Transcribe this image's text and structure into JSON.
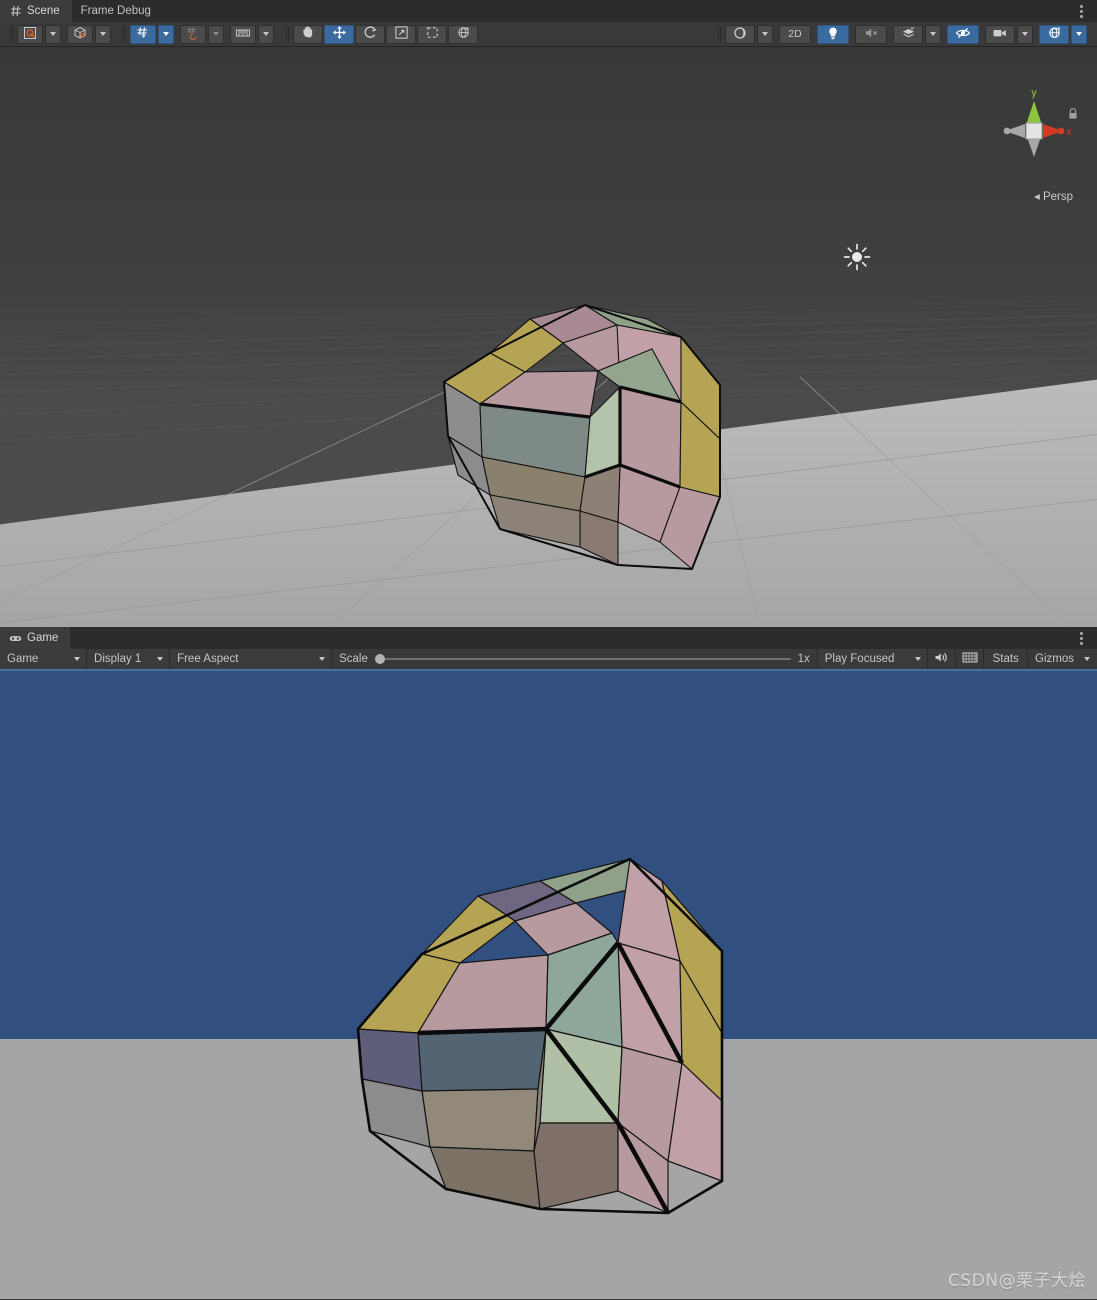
{
  "window": {
    "tabs": [
      {
        "label": "Scene",
        "icon": "grid-hash-icon",
        "active": true
      },
      {
        "label": "Frame Debug",
        "icon": "none",
        "active": false
      }
    ],
    "overflow_menu": "kebab-menu-icon"
  },
  "scene_toolbar": {
    "groups": [
      {
        "name": "pivot-group",
        "items": [
          {
            "name": "pivot-mode-button",
            "icon": "pivot-center-icon",
            "label": "",
            "active": false,
            "dropdown": true
          },
          {
            "name": "handle-orientation-button",
            "icon": "global-local-cube-icon",
            "label": "",
            "active": false,
            "dropdown": true
          }
        ]
      },
      {
        "name": "snap-group",
        "items": [
          {
            "name": "grid-snap-button",
            "icon": "grid-snap-icon",
            "label": "",
            "active": true,
            "dropdown": true
          },
          {
            "name": "surface-snap-button",
            "icon": "surface-snap-icon",
            "label": "",
            "active": false,
            "dropdown": true
          },
          {
            "name": "grid-size-button",
            "icon": "grid-ruler-icon",
            "label": "",
            "active": false,
            "dropdown": true
          }
        ]
      },
      {
        "name": "transform-tools-group",
        "items": [
          {
            "name": "hand-tool-button",
            "icon": "hand-icon",
            "label": "",
            "active": false,
            "dropdown": false
          },
          {
            "name": "move-tool-button",
            "icon": "move-arrows-icon",
            "label": "",
            "active": true,
            "dropdown": false
          },
          {
            "name": "rotate-tool-button",
            "icon": "rotate-icon",
            "label": "",
            "active": false,
            "dropdown": false
          },
          {
            "name": "scale-tool-button",
            "icon": "scale-icon",
            "label": "",
            "active": false,
            "dropdown": false
          },
          {
            "name": "rect-tool-button",
            "icon": "rect-transform-icon",
            "label": "",
            "active": false,
            "dropdown": false
          },
          {
            "name": "transform-tool-button",
            "icon": "transform-combined-icon",
            "label": "",
            "active": false,
            "dropdown": false
          }
        ]
      }
    ],
    "right_items": [
      {
        "name": "draw-mode-button",
        "icon": "shaded-sphere-icon",
        "label": "",
        "active": false,
        "dropdown": true
      },
      {
        "name": "2d-toggle-button",
        "icon": "none",
        "label": "2D",
        "active": false,
        "dropdown": false
      },
      {
        "name": "scene-lighting-button",
        "icon": "lightbulb-icon",
        "label": "",
        "active": true,
        "dropdown": false
      },
      {
        "name": "scene-audio-button",
        "icon": "audio-muted-icon",
        "label": "",
        "active": false,
        "dropdown": false
      },
      {
        "name": "fx-button",
        "icon": "effects-layers-icon",
        "label": "",
        "active": false,
        "dropdown": true
      },
      {
        "name": "scene-visibility-button",
        "icon": "eye-crossed-icon",
        "label": "",
        "active": true,
        "dropdown": false
      },
      {
        "name": "camera-settings-button",
        "icon": "camera-icon",
        "label": "",
        "active": false,
        "dropdown": true
      },
      {
        "name": "gizmos-button",
        "icon": "gizmos-globe-icon",
        "label": "",
        "active": true,
        "dropdown": true
      }
    ]
  },
  "scene_view": {
    "axis_gizmo": {
      "y_label": "y",
      "x_label": "x",
      "y_color": "#8ec73f",
      "x_color": "#d33b26",
      "z_color": "#a8a8a8",
      "center_color": "#e4e4e4"
    },
    "projection_label": "Persp",
    "lock_icon": "padlock-icon",
    "light_gizmo_icon": "directional-light-sun-icon",
    "background_color": "#3f3f3f",
    "ground_color": "#b0b0b0",
    "grid_color": "#6e6e6e"
  },
  "game_panel": {
    "tab": {
      "label": "Game",
      "icon": "gamepad-icon"
    },
    "overflow_menu": "kebab-menu-icon",
    "toolbar": {
      "view_selector": {
        "name": "game-view-selector",
        "value": "Game"
      },
      "display_selector": {
        "name": "display-selector",
        "value": "Display 1"
      },
      "aspect_selector": {
        "name": "aspect-ratio-selector",
        "value": "Free Aspect"
      },
      "scale": {
        "label": "Scale",
        "value": "1x",
        "percent": 0
      },
      "play_mode_selector": {
        "name": "play-focus-selector",
        "value": "Play Focused"
      },
      "mute_audio": {
        "name": "mute-audio-button",
        "icon": "speaker-icon"
      },
      "aspect_icon": {
        "name": "low-resolution-aspect-button",
        "icon": "pixel-grid-icon"
      },
      "stats": {
        "name": "stats-button",
        "label": "Stats"
      },
      "gizmos": {
        "name": "gizmos-dropdown",
        "label": "Gizmos"
      }
    },
    "sky_color": "#32507f",
    "ground_color": "#a5a5a5",
    "accent_underline": "#4a6f9e"
  },
  "cube_colors": {
    "mauve": "#a98a93",
    "sage": "#8fa188",
    "olive": "#b6a455",
    "pink": "#c2a0a8",
    "pale_green": "#b0c0a6",
    "dusty_rose": "#b79aa0",
    "slate_purple": "#6f6782",
    "shadow_warm": "#8f8271",
    "shadow_cool": "#6e7a83",
    "outline": "#111111"
  },
  "watermark": {
    "text": "CSDN@栗子大烩"
  }
}
